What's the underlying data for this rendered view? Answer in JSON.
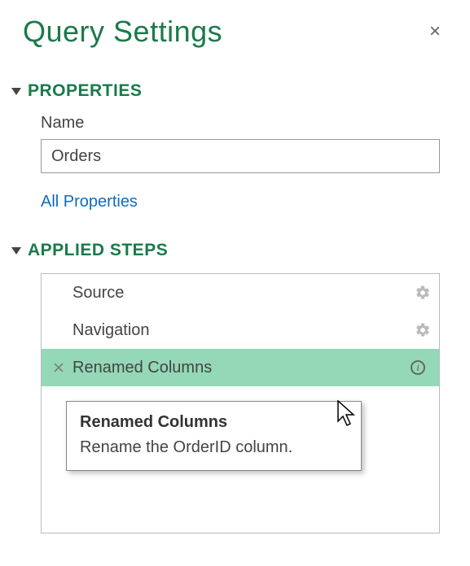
{
  "panel": {
    "title": "Query Settings",
    "close_label": "×"
  },
  "properties": {
    "heading": "PROPERTIES",
    "name_label": "Name",
    "name_value": "Orders",
    "all_properties_link": "All Properties"
  },
  "applied_steps": {
    "heading": "APPLIED STEPS",
    "steps": [
      {
        "label": "Source",
        "has_gear": true,
        "selected": false,
        "has_x": false,
        "has_info": false
      },
      {
        "label": "Navigation",
        "has_gear": true,
        "selected": false,
        "has_x": false,
        "has_info": false
      },
      {
        "label": "Renamed Columns",
        "has_gear": false,
        "selected": true,
        "has_x": true,
        "has_info": true
      }
    ]
  },
  "tooltip": {
    "title": "Renamed Columns",
    "description": "Rename the OrderID column."
  },
  "icons": {
    "info_glyph": "i"
  }
}
